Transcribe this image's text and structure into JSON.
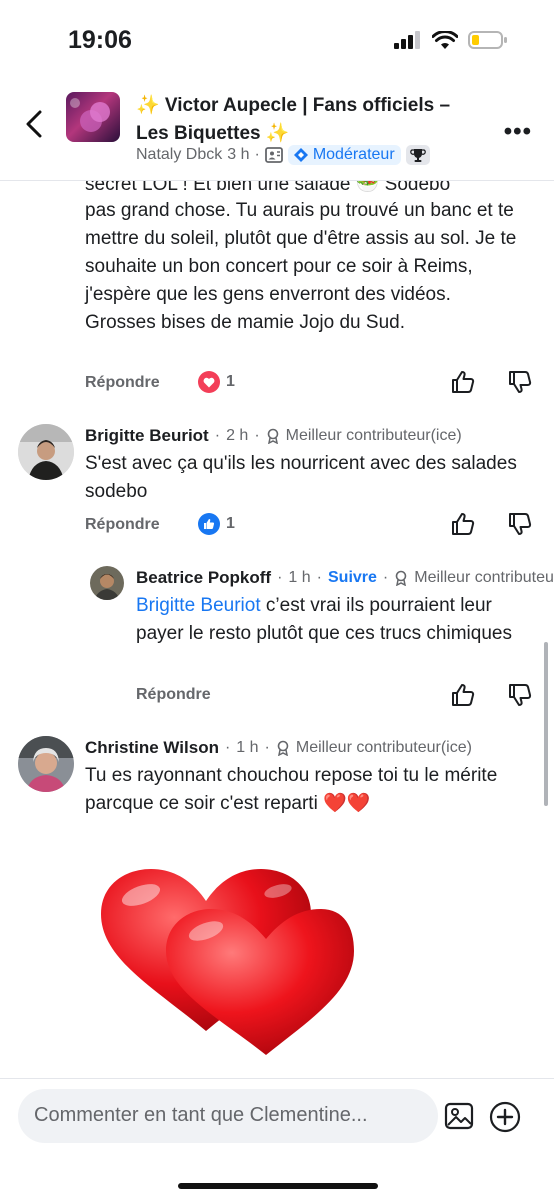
{
  "status": {
    "time": "19:06"
  },
  "header": {
    "title": "✨ Victor Aupecle | Fans officiels – Les Biquettes ✨",
    "author": "Nataly Dbck",
    "age": "3 h",
    "dot": "·",
    "badge": "Modérateur"
  },
  "comments": {
    "prev": {
      "cut_line": "secret LOL ! Et bien une salade 🥗 Sodebo",
      "text": "pas grand chose. Tu aurais pu trouvé un banc et te mettre du soleil, plutôt que d'être assis au sol. Je te souhaite un bon concert pour ce soir à Reims, j'espère que les gens enverront des vidéos.  Grosses bises de mamie Jojo du Sud.",
      "reply": "Répondre",
      "count": "1"
    },
    "brigitte": {
      "name": "Brigitte Beuriot",
      "age": "2 h",
      "badge": "Meilleur contributeur(ice)",
      "text": "S'est avec ça qu'ils les nourricent avec des salades sodebo",
      "reply": "Répondre",
      "count": "1"
    },
    "beatrice": {
      "name": "Beatrice Popkoff",
      "age": "1 h",
      "follow": "Suivre",
      "badge": "Meilleur contributeur(ice)",
      "mention": "Brigitte Beuriot",
      "text": " c’est vrai ils pourraient leur payer le resto plutôt que ces trucs chimiques",
      "reply": "Répondre"
    },
    "christine": {
      "name": "Christine Wilson",
      "age": "1 h",
      "badge": "Meilleur contributeur(ice)",
      "text": "Tu es rayonnant chouchou repose toi tu le mérite parcque ce soir c'est reparti ❤️❤️"
    }
  },
  "composer": {
    "placeholder": "Commenter en tant que Clementine..."
  },
  "colors": {
    "accent": "#1877f2",
    "love": "#f33e58",
    "heart": "#e8101a"
  }
}
